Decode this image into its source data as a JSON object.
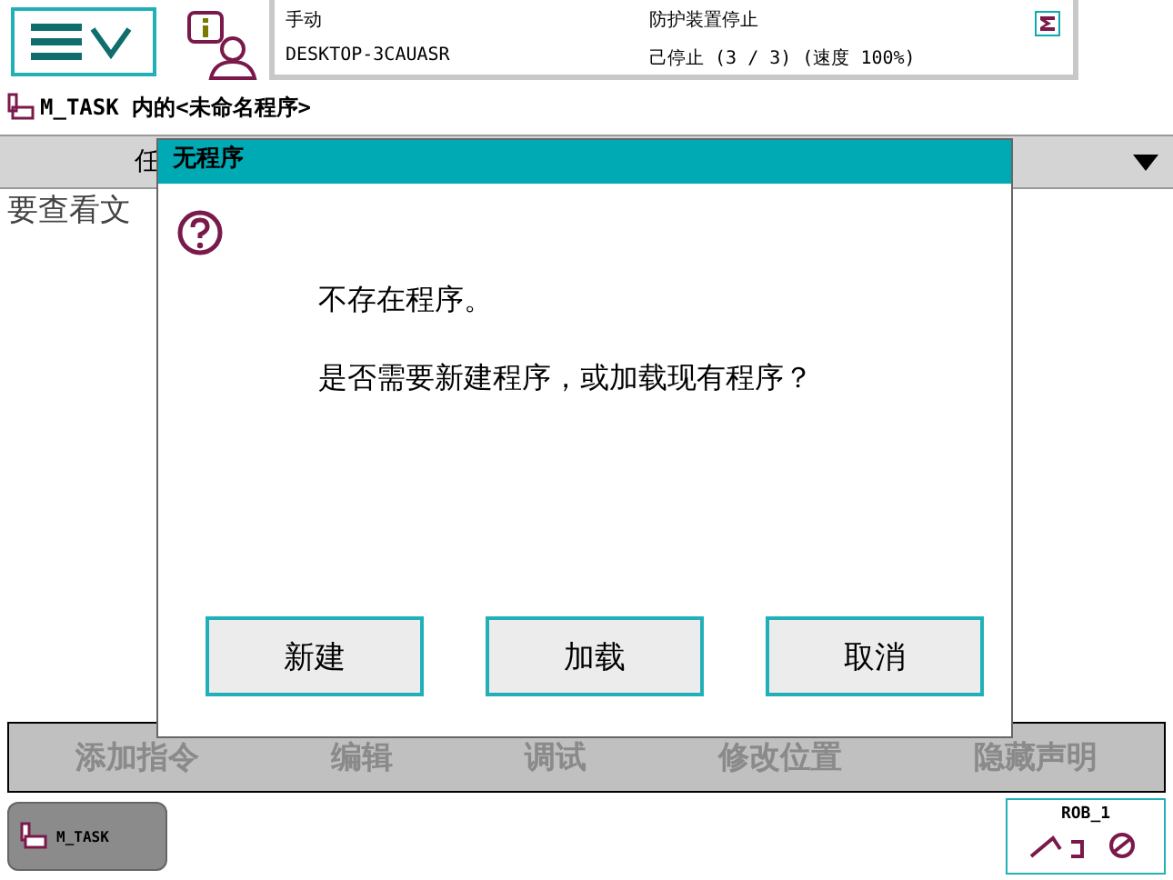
{
  "status": {
    "mode": "手动",
    "system": "DESKTOP-3CAUASR",
    "guard": "防护装置停止",
    "state": "己停止 (3 / 3) (速度 100%)"
  },
  "breadcrumb": "M_TASK 内的<未命名程序>",
  "table": {
    "columns": [
      "任"
    ]
  },
  "hint": "要查看文",
  "dialog": {
    "title": "无程序",
    "message": "不存在程序。",
    "question": "是否需要新建程序，或加载现有程序？",
    "buttons": [
      "新建",
      "加载",
      "取消"
    ]
  },
  "toolbar": [
    {
      "label": "添加指令",
      "disabled": true
    },
    {
      "label": "编辑",
      "disabled": true
    },
    {
      "label": "调试",
      "disabled": true
    },
    {
      "label": "修改位置",
      "disabled": true
    },
    {
      "label": "隐藏声明",
      "disabled": true
    }
  ],
  "taskbar": {
    "task": "M_TASK",
    "robot": "ROB_1"
  }
}
